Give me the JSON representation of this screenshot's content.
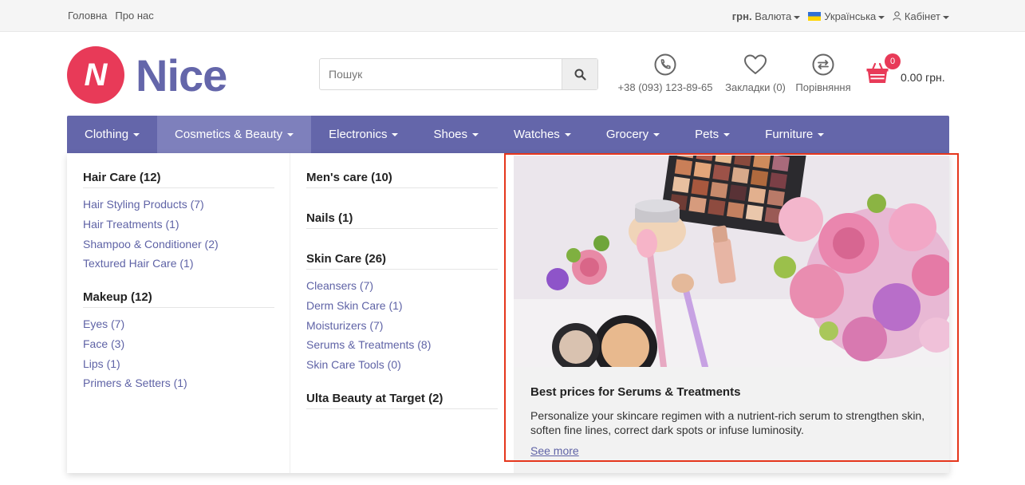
{
  "topbar": {
    "links": [
      "Головна",
      "Про нас"
    ],
    "currency_code": "грн.",
    "currency_label": "Валюта",
    "language": "Українська",
    "account": "Кабінет"
  },
  "logo": {
    "letter": "N",
    "text": "Nice"
  },
  "search": {
    "placeholder": "Пошук"
  },
  "header": {
    "phone": "+38 (093) 123-89-65",
    "wishlist": "Закладки (0)",
    "compare": "Порівняння",
    "cart_count": "0",
    "cart_total": "0.00 грн."
  },
  "menu": [
    "Clothing",
    "Cosmetics & Beauty",
    "Electronics",
    "Shoes",
    "Watches",
    "Grocery",
    "Pets",
    "Furniture"
  ],
  "dropdown": {
    "col1": [
      {
        "title": "Hair Care (12)",
        "items": [
          "Hair Styling Products (7)",
          "Hair Treatments (1)",
          "Shampoo & Conditioner (2)",
          "Textured Hair Care (1)"
        ]
      },
      {
        "title": "Makeup (12)",
        "items": [
          "Eyes (7)",
          "Face (3)",
          "Lips (1)",
          "Primers & Setters (1)"
        ]
      }
    ],
    "col2": [
      {
        "title": "Men's care (10)",
        "items": []
      },
      {
        "title": "Nails (1)",
        "items": []
      },
      {
        "title": "Skin Care (26)",
        "items": [
          "Cleansers (7)",
          "Derm Skin Care (1)",
          "Moisturizers (7)",
          "Serums & Treatments (8)",
          "Skin Care Tools (0)"
        ]
      },
      {
        "title": "Ulta Beauty at Target (2)",
        "items": []
      }
    ],
    "promo": {
      "title": "Best prices for Serums & Treatments",
      "description": "Personalize your skincare regimen with a nutrient-rich serum to strengthen skin, soften fine lines, correct dark spots or infuse luminosity.",
      "link": "See more"
    }
  },
  "colors": {
    "brand": "#6466aa",
    "accent": "#e83a58",
    "link": "#5f63a6",
    "highlight": "#e5361c"
  }
}
